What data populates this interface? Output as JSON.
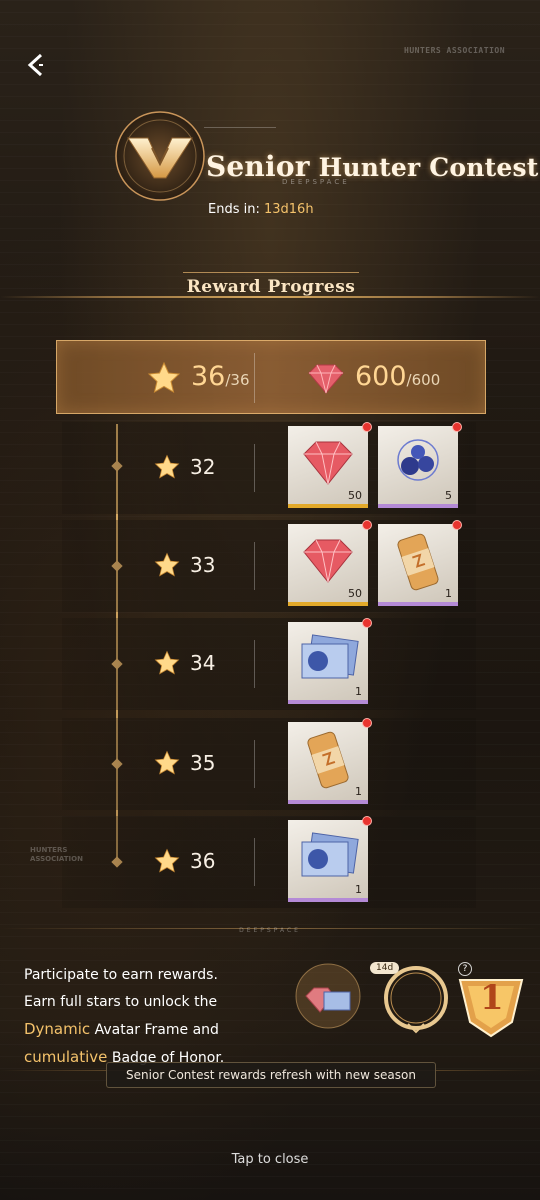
{
  "header": {
    "title_big": "Senior",
    "title_rest": "Hunter Contest",
    "subtitle": "DEEPSPACE",
    "ends_label": "Ends in: ",
    "ends_value": "13d16h",
    "side_title": "HUNTERS ASSOCIATION"
  },
  "section_title": "Reward Progress",
  "summary": {
    "stars_current": "36",
    "stars_total": "/36",
    "gems_current": "600",
    "gems_total": "/600"
  },
  "rows": [
    {
      "stars": "32",
      "items": [
        {
          "name": "gem",
          "count": "50",
          "rarity": "gold"
        },
        {
          "name": "orb",
          "count": "5",
          "rarity": "purple"
        }
      ]
    },
    {
      "stars": "33",
      "items": [
        {
          "name": "gem",
          "count": "50",
          "rarity": "gold"
        },
        {
          "name": "drink-can",
          "count": "1",
          "rarity": "purple"
        }
      ]
    },
    {
      "stars": "34",
      "items": [
        {
          "name": "card",
          "count": "1",
          "rarity": "purple"
        }
      ]
    },
    {
      "stars": "35",
      "items": [
        {
          "name": "drink-can",
          "count": "1",
          "rarity": "purple"
        }
      ]
    },
    {
      "stars": "36",
      "items": [
        {
          "name": "card",
          "count": "1",
          "rarity": "purple"
        }
      ]
    }
  ],
  "footer": {
    "line1": "Participate to earn rewards.",
    "line2": "Earn full stars to unlock the",
    "dynamic": "Dynamic",
    "avatar_frame": " Avatar Frame and",
    "cumulative": "cumulative",
    "badge": " Badge of Honor.",
    "refresh_note": "Senior Contest rewards refresh with new season",
    "days_badge": "14d",
    "help": "?",
    "badge_number": "1",
    "deepspace": "DEEPSPACE",
    "hunters": "HUNTERS ASSOCIATION"
  },
  "close_label": "Tap to close",
  "colors": {
    "accent": "#f4c26b",
    "gold_border": "#e2a92a",
    "purple_border": "#b48ad6",
    "red_dot": "#e8342f"
  }
}
